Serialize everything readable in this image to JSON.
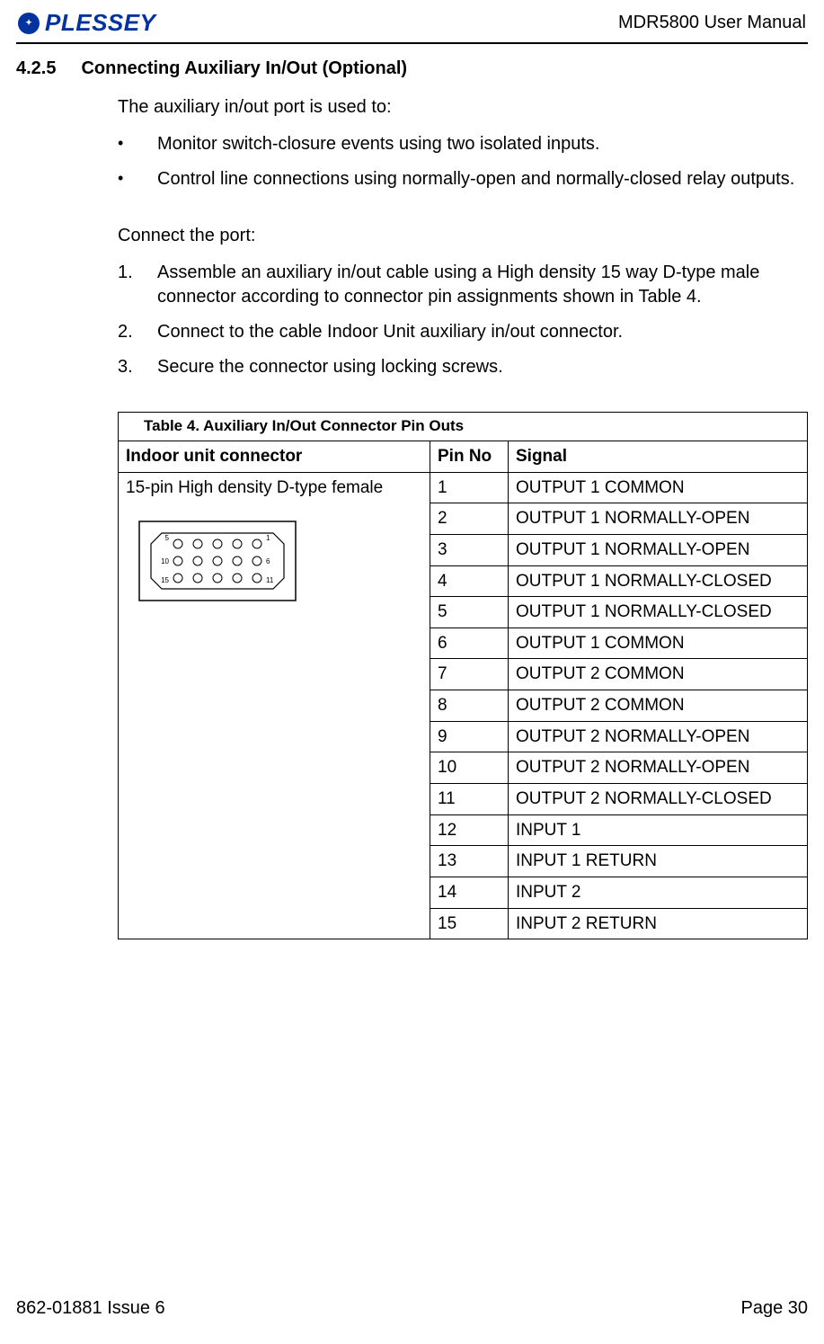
{
  "header": {
    "brand": "PLESSEY",
    "doc_title": "MDR5800 User Manual"
  },
  "section": {
    "number": "4.2.5",
    "title": "Connecting Auxiliary In/Out (Optional)"
  },
  "intro_para": "The auxiliary in/out port is used to:",
  "bullets": [
    "Monitor switch-closure events using two isolated inputs.",
    "Control line connections using normally-open and normally-closed relay outputs."
  ],
  "connect_label": "Connect the port:",
  "steps": [
    "Assemble an auxiliary in/out cable using a High density 15 way D-type male connector according to connector pin assignments shown in Table 4.",
    "Connect to the cable Indoor Unit auxiliary in/out connector.",
    "Secure the connector using locking screws."
  ],
  "table": {
    "caption": "Table 4.  Auxiliary In/Out Connector Pin Outs",
    "headers": {
      "connector": "Indoor unit connector",
      "pin": "Pin No",
      "signal": "Signal"
    },
    "connector_label": "15-pin High density D-type female",
    "connector_pin_numbers": {
      "top_left": "5",
      "top_right": "1",
      "mid_left": "10",
      "mid_right": "6",
      "bot_left": "15",
      "bot_right": "11"
    },
    "rows": [
      {
        "pin": "1",
        "signal": "OUTPUT 1 COMMON"
      },
      {
        "pin": "2",
        "signal": "OUTPUT 1 NORMALLY-OPEN"
      },
      {
        "pin": "3",
        "signal": "OUTPUT 1 NORMALLY-OPEN"
      },
      {
        "pin": "4",
        "signal": "OUTPUT 1 NORMALLY-CLOSED"
      },
      {
        "pin": "5",
        "signal": "OUTPUT 1 NORMALLY-CLOSED"
      },
      {
        "pin": "6",
        "signal": "OUTPUT 1 COMMON"
      },
      {
        "pin": "7",
        "signal": "OUTPUT 2 COMMON"
      },
      {
        "pin": "8",
        "signal": "OUTPUT 2 COMMON"
      },
      {
        "pin": "9",
        "signal": "OUTPUT 2 NORMALLY-OPEN"
      },
      {
        "pin": "10",
        "signal": "OUTPUT 2 NORMALLY-OPEN"
      },
      {
        "pin": "11",
        "signal": "OUTPUT 2 NORMALLY-CLOSED"
      },
      {
        "pin": "12",
        "signal": "INPUT 1"
      },
      {
        "pin": "13",
        "signal": "INPUT 1 RETURN"
      },
      {
        "pin": "14",
        "signal": "INPUT 2"
      },
      {
        "pin": "15",
        "signal": "INPUT 2 RETURN"
      }
    ]
  },
  "footer": {
    "left": "862-01881 Issue 6",
    "right": "Page 30"
  }
}
